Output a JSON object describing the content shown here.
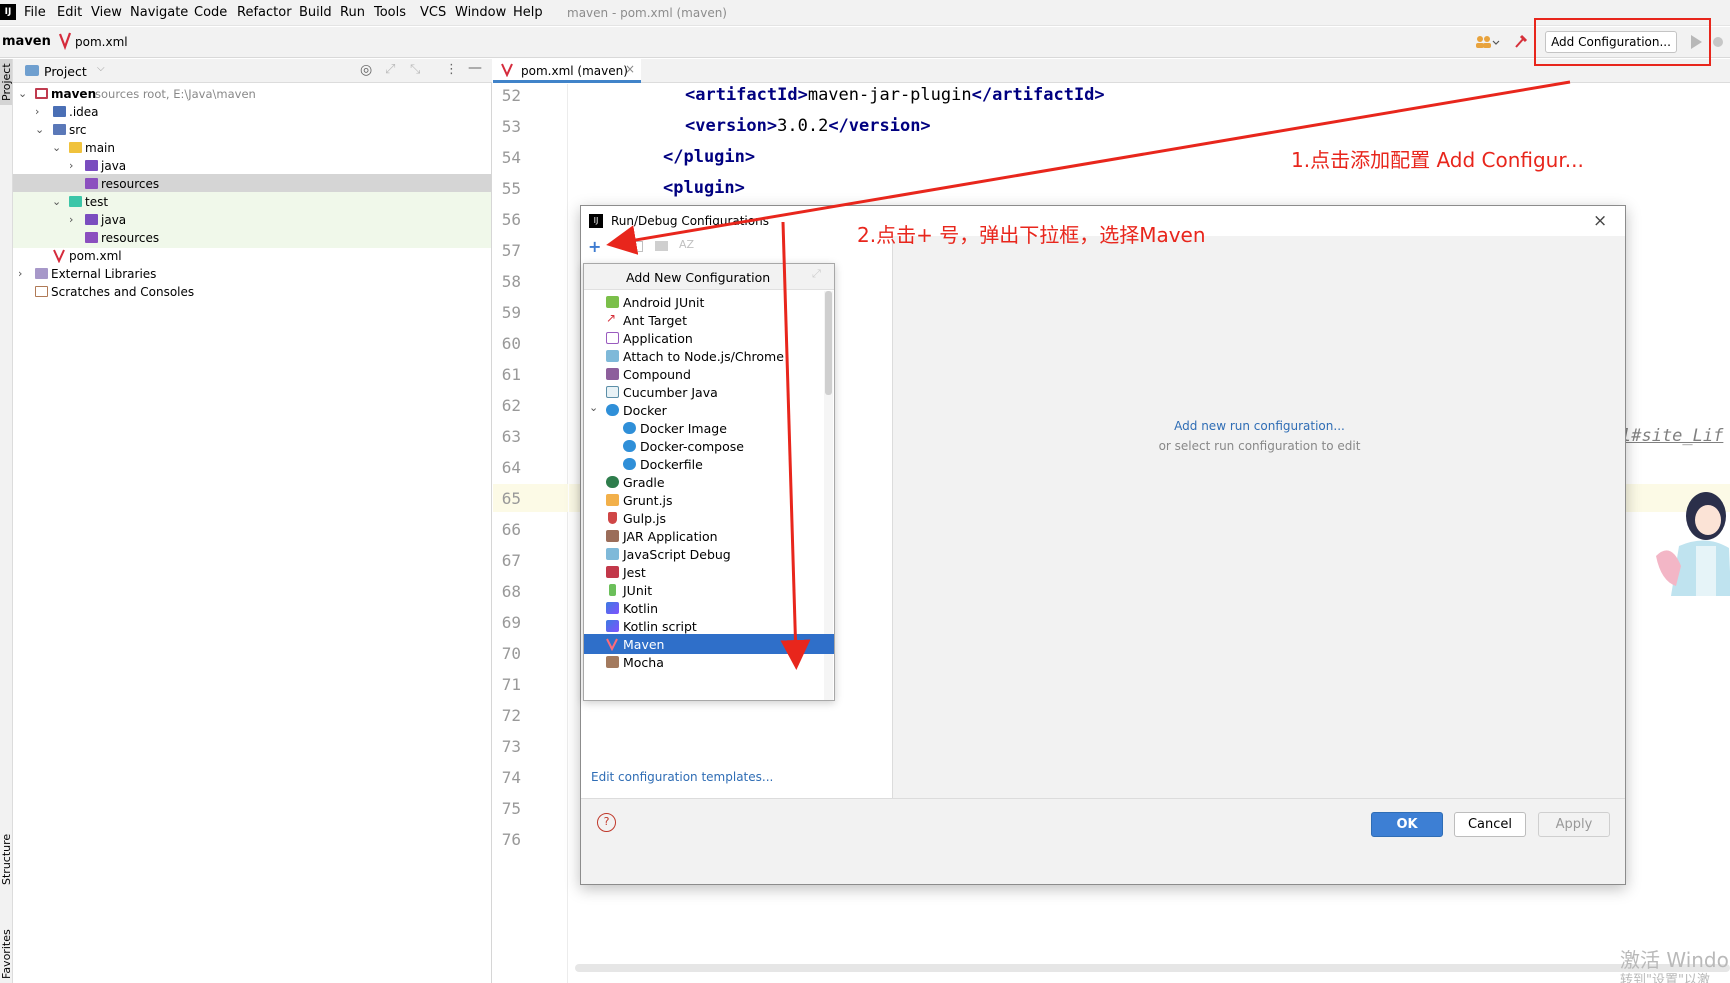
{
  "menubar": {
    "logo": "IJ",
    "items": [
      "File",
      "Edit",
      "View",
      "Navigate",
      "Code",
      "Refactor",
      "Build",
      "Run",
      "Tools",
      "VCS",
      "Window",
      "Help"
    ],
    "window_title": "maven - pom.xml (maven)"
  },
  "toolbar": {
    "project": "maven",
    "file": "pom.xml",
    "add_configuration": "Add Configuration..."
  },
  "side_stripe": {
    "project": "Project",
    "structure": "Structure",
    "favorites": "Favorites"
  },
  "project_panel": {
    "title": "Project",
    "tree": [
      {
        "label": "maven",
        "suffix": "sources root,  E:\\Java\\maven"
      },
      {
        "label": ".idea"
      },
      {
        "label": "src"
      },
      {
        "label": "main"
      },
      {
        "label": "java"
      },
      {
        "label": "resources"
      },
      {
        "label": "test"
      },
      {
        "label": "java"
      },
      {
        "label": "resources"
      },
      {
        "label": "pom.xml"
      },
      {
        "label": "External Libraries"
      },
      {
        "label": "Scratches and Consoles"
      }
    ]
  },
  "editor": {
    "tab": "pom.xml (maven)",
    "line_numbers": [
      "52",
      "53",
      "54",
      "55",
      "56",
      "57",
      "58",
      "59",
      "60",
      "61",
      "62",
      "63",
      "64",
      "65",
      "66",
      "67",
      "68",
      "69",
      "70",
      "71",
      "72",
      "73",
      "74",
      "75",
      "76"
    ],
    "code": {
      "l52_open": "<artifactId>",
      "l52_text": "maven-jar-plugin",
      "l52_close": "</artifactId>",
      "l53_open": "<version>",
      "l53_text": "3.0.2",
      "l53_close": "</version>",
      "l54": "</plugin>",
      "l55": "<plugin>",
      "l63_fragment": "l#site_Lif"
    }
  },
  "dialog": {
    "title": "Run/Debug Configurations",
    "add_new_configuration": "Add New Configuration",
    "items": [
      "Android JUnit",
      "Ant Target",
      "Application",
      "Attach to Node.js/Chrome",
      "Compound",
      "Cucumber Java",
      "Docker",
      "Docker Image",
      "Docker-compose",
      "Dockerfile",
      "Gradle",
      "Grunt.js",
      "Gulp.js",
      "JAR Application",
      "JavaScript Debug",
      "Jest",
      "JUnit",
      "Kotlin",
      "Kotlin script",
      "Maven",
      "Mocha"
    ],
    "selected_item": "Maven",
    "right_link": "Add new run configuration...",
    "right_hint": "or select run configuration to edit",
    "templates_link": "Edit configuration templates...",
    "ok": "OK",
    "cancel": "Cancel",
    "apply": "Apply"
  },
  "annotations": {
    "step1": "1.点击添加配置 Add Configur...",
    "step2": "2.点击+ 号，弹出下拉框，选择Maven"
  },
  "watermark": {
    "line1": "激活 Windo",
    "line2": "转到\"设置\"以激"
  },
  "colors": {
    "accent": "#2f6fc9",
    "annotation": "#e8261c",
    "tag": "#000080"
  }
}
